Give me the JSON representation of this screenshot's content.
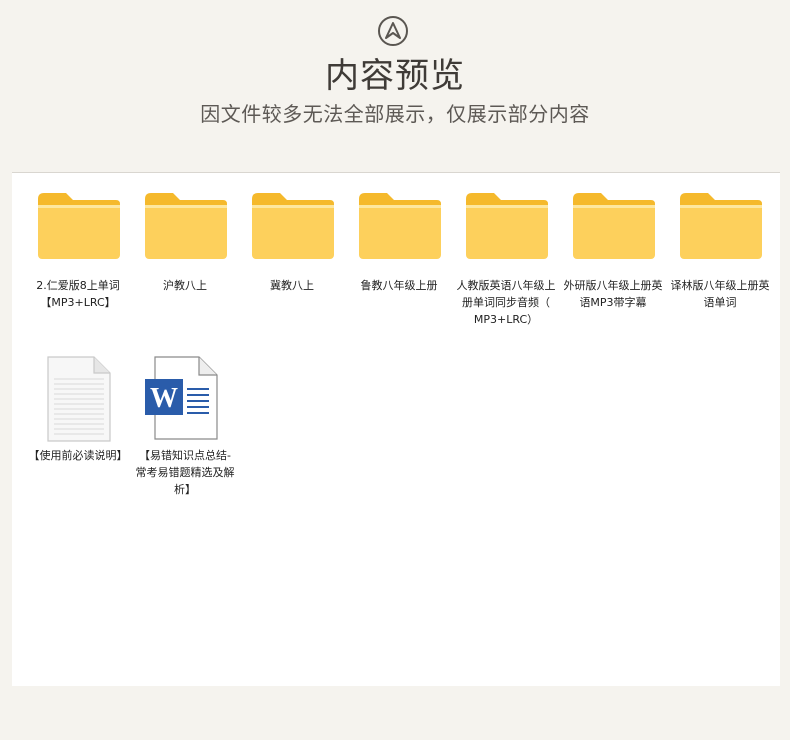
{
  "header": {
    "title": "内容预览",
    "subtitle": "因文件较多无法全部展示，仅展示部分内容",
    "logo_icon": "compass-arrow-icon"
  },
  "files": [
    {
      "label": "2.仁爱版8上单词【MP3+LRC】",
      "icon": "folder-icon"
    },
    {
      "label": "沪教八上",
      "icon": "folder-icon"
    },
    {
      "label": "冀教八上",
      "icon": "folder-icon"
    },
    {
      "label": "鲁教八年级上册",
      "icon": "folder-icon"
    },
    {
      "label": "人教版英语八年级上册单词同步音频（ MP3+LRC）",
      "icon": "folder-icon"
    },
    {
      "label": "外研版八年级上册英语MP3带字幕",
      "icon": "folder-icon"
    },
    {
      "label": "译林版八年级上册英语单词",
      "icon": "folder-icon"
    },
    {
      "label": "【使用前必读说明】",
      "icon": "text-document-icon"
    },
    {
      "label": "【易错知识点总结-常考易错题精选及解析】",
      "icon": "word-document-icon"
    }
  ],
  "colors": {
    "folder_front": "#fdd05c",
    "folder_back": "#f5b92c",
    "word_blue": "#2a5caa",
    "page_bg": "#f5f3ee"
  }
}
